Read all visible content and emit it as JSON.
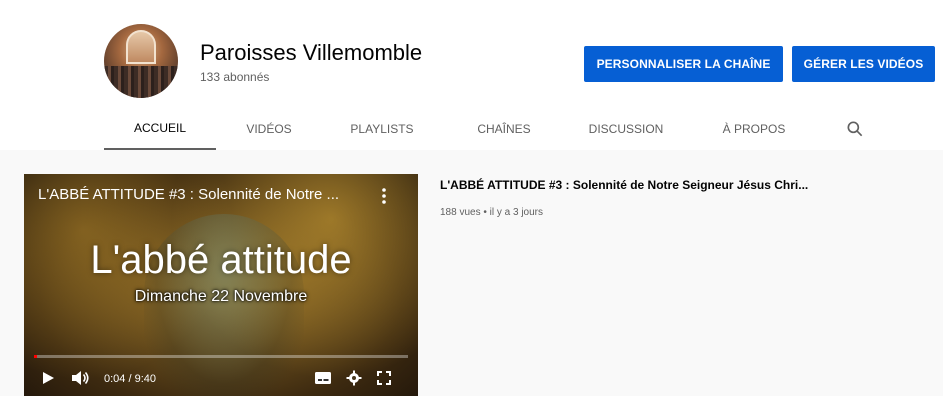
{
  "channel": {
    "name": "Paroisses Villemomble",
    "subscribers": "133 abonnés"
  },
  "buttons": {
    "customize": "PERSONNALISER LA CHAÎNE",
    "manage": "GÉRER LES VIDÉOS"
  },
  "tabs": [
    {
      "label": "ACCUEIL",
      "active": true
    },
    {
      "label": "VIDÉOS"
    },
    {
      "label": "PLAYLISTS"
    },
    {
      "label": "CHAÎNES"
    },
    {
      "label": "DISCUSSION"
    },
    {
      "label": "À PROPOS"
    }
  ],
  "icons": {
    "search": "search-icon",
    "more": "more-vert-icon",
    "play": "play-icon",
    "volume": "volume-icon",
    "subtitles": "subtitles-icon",
    "settings": "gear-icon",
    "fullscreen": "fullscreen-icon"
  },
  "player": {
    "overlay_title": "L'ABBÉ ATTITUDE #3 : Solennité de Notre ...",
    "thumbnail_title": "L'abbé attitude",
    "thumbnail_subtitle": "Dimanche 22 Novembre",
    "time_display": "0:04 / 9:40",
    "progress_fraction": 0.007
  },
  "video": {
    "title": "L'ABBÉ ATTITUDE #3 : Solennité de Notre Seigneur Jésus Chri...",
    "meta": "188 vues • il y a 3 jours"
  },
  "colors": {
    "accent": "#065fd4",
    "progress": "#ff0000"
  }
}
